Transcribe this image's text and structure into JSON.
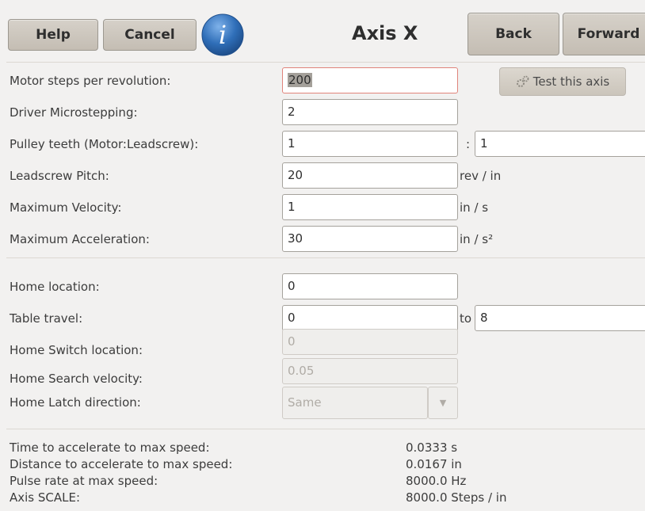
{
  "header": {
    "help_label": "Help",
    "cancel_label": "Cancel",
    "info_glyph": "i",
    "title": "Axis X",
    "back_label": "Back",
    "forward_label": "Forward"
  },
  "test_button": {
    "label": "Test this axis",
    "icon": "gears-icon"
  },
  "motor": {
    "steps_label": "Motor steps per revolution:",
    "steps_value": "200",
    "microstep_label": "Driver Microstepping:",
    "microstep_value": "2",
    "pulley_label": "Pulley teeth (Motor:Leadscrew):",
    "pulley_motor": "1",
    "pulley_sep": ":",
    "pulley_leadscrew": "1",
    "pitch_label": "Leadscrew Pitch:",
    "pitch_value": "20",
    "pitch_unit": "rev / in",
    "velocity_label": "Maximum Velocity:",
    "velocity_value": "1",
    "velocity_unit": "in / s",
    "accel_label": "Maximum Acceleration:",
    "accel_value": "30",
    "accel_unit": "in / s²"
  },
  "homing": {
    "home_label": "Home location:",
    "home_value": "0",
    "travel_label": "Table travel:",
    "travel_min": "0",
    "travel_to": "to",
    "travel_max": "8",
    "switch_label": "Home Switch location:",
    "switch_value": "0",
    "search_label": "Home Search velocity:",
    "search_value": "0.05",
    "latch_label": "Home Latch direction:",
    "latch_value": "Same"
  },
  "stats": [
    {
      "label": "Time to accelerate to max speed:",
      "value": "0.0333 s"
    },
    {
      "label": "Distance to accelerate to max speed:",
      "value": "0.0167 in"
    },
    {
      "label": "Pulse rate at max speed:",
      "value": "8000.0 Hz"
    },
    {
      "label": "Axis SCALE:",
      "value": "8000.0 Steps / in"
    }
  ],
  "colors": {
    "background": "#f2f1f0",
    "info_blue": "#2f6eb8",
    "focus_border": "#e0837a"
  }
}
